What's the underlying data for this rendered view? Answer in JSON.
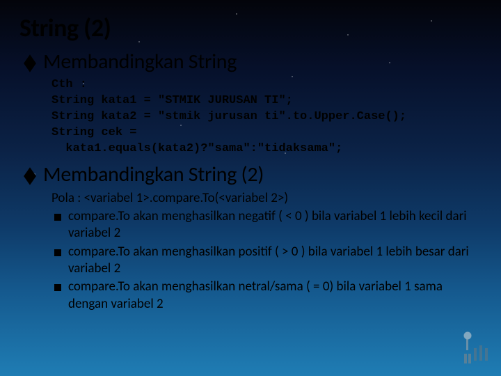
{
  "title": "String (2)",
  "section1": {
    "heading": "Membandingkan String",
    "code": "Cth :\nString kata1 = \"STMIK JURUSAN TI\";\nString kata2 = \"stmik jurusan ti\".to.Upper.Case();\nString cek =\n  kata1.equals(kata2)?\"sama\":\"tidaksama\";"
  },
  "section2": {
    "heading": "Membandingkan String (2)",
    "pattern": "Pola : <variabel 1>.compare.To(<variabel 2>)",
    "bullets": [
      "compare.To akan menghasilkan negatif ( < 0 ) bila variabel 1 lebih kecil dari variabel 2",
      "compare.To akan menghasilkan positif ( > 0 ) bila variabel 1 lebih besar dari variabel 2",
      "compare.To akan menghasilkan netral/sama ( = 0) bila variabel 1 sama dengan variabel 2"
    ]
  }
}
